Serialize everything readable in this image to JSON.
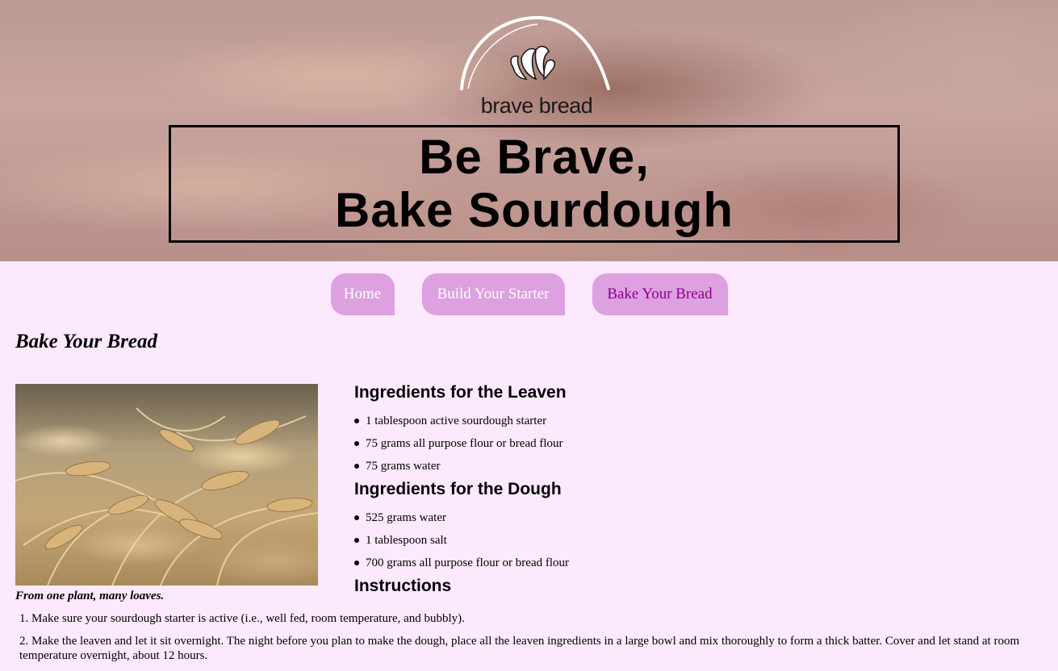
{
  "brand": {
    "logo_text": "brave bread"
  },
  "hero": {
    "headline_line1": "Be Brave,",
    "headline_line2": "Bake Sourdough"
  },
  "nav": [
    {
      "label": "Home",
      "active": false
    },
    {
      "label": "Build Your Starter",
      "active": false
    },
    {
      "label": "Bake Your Bread",
      "active": true
    }
  ],
  "page": {
    "title": "Bake Your Bread"
  },
  "figure": {
    "caption": "From one plant, many loaves."
  },
  "leaven": {
    "heading": "Ingredients for the Leaven",
    "items": [
      "1 tablespoon active sourdough starter",
      "75 grams all purpose flour or bread flour",
      "75 grams water"
    ]
  },
  "dough": {
    "heading": "Ingredients for the Dough",
    "items": [
      "525 grams water",
      "1 tablespoon salt",
      "700 grams all purpose flour or bread flour"
    ]
  },
  "instructions": {
    "heading": "Instructions",
    "steps": [
      {
        "num": "1.",
        "text": "Make sure your sourdough starter is active (i.e., well fed, room temperature, and bubbly)."
      },
      {
        "num": "2.",
        "text": "Make the leaven and let it sit overnight. The night before you plan to make the dough, place all the leaven ingredients in a large bowl and mix thoroughly to form a thick batter. Cover and let stand at room temperature overnight, about 12 hours."
      }
    ]
  },
  "colors": {
    "background": "#fde9fd",
    "nav_tab": "#dda0e0",
    "nav_active_text": "#8b008b"
  }
}
